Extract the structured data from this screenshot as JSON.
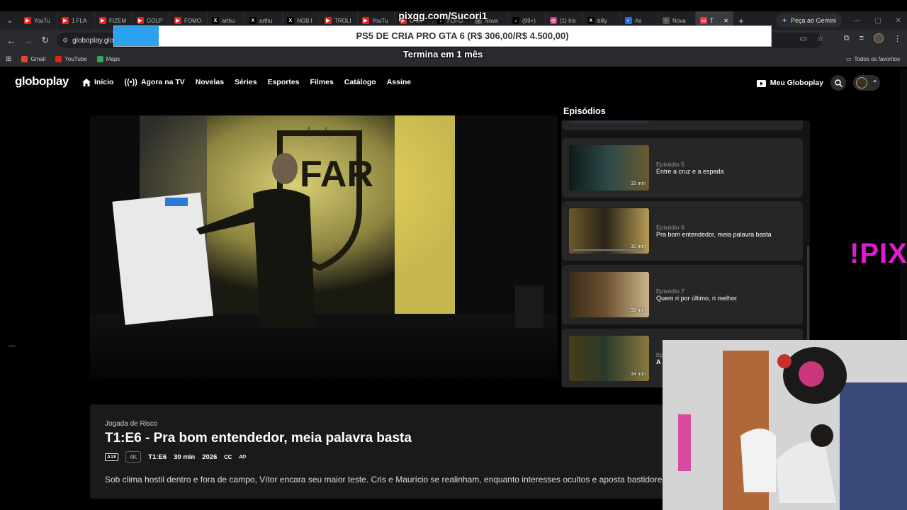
{
  "browser": {
    "tabs": [
      {
        "label": "YouTu",
        "color": "#e62117",
        "glyph": "▶"
      },
      {
        "label": "1 FLA",
        "color": "#e62117",
        "glyph": "▶"
      },
      {
        "label": "FIZEM",
        "color": "#e62117",
        "glyph": "▶"
      },
      {
        "label": "GOLP",
        "color": "#e62117",
        "glyph": "▶"
      },
      {
        "label": "FOMO",
        "color": "#e62117",
        "glyph": "▶"
      },
      {
        "label": "arthu",
        "color": "#000000",
        "glyph": "X"
      },
      {
        "label": "arthu",
        "color": "#000000",
        "glyph": "X"
      },
      {
        "label": "NGB I",
        "color": "#000000",
        "glyph": "X"
      },
      {
        "label": "TROLI",
        "color": "#e62117",
        "glyph": "▶"
      },
      {
        "label": "YouTu",
        "color": "#e62117",
        "glyph": "▶"
      },
      {
        "label": "O MI",
        "color": "#e62117",
        "glyph": "▶"
      },
      {
        "label": "FOFO",
        "color": "#000000",
        "glyph": "♪"
      },
      {
        "label": "Nova",
        "color": "#555555",
        "glyph": "○"
      },
      {
        "label": "(99+)",
        "color": "#000000",
        "glyph": "♪"
      },
      {
        "label": "(1) Ins",
        "color": "#c13584",
        "glyph": "◎"
      },
      {
        "label": "billy",
        "color": "#000000",
        "glyph": "X"
      },
      {
        "label": "As",
        "color": "#1a73e8",
        "glyph": "◐"
      },
      {
        "label": "Nova",
        "color": "#555555",
        "glyph": "○"
      },
      {
        "label": "T",
        "color": "#e9334a",
        "glyph": "▭"
      }
    ],
    "active_tab_index": 18,
    "gemini_label": "Peça ao Gemini",
    "url": "globoplay.glo",
    "bookmarks": [
      {
        "label": "Gmail",
        "color": "#ea4335"
      },
      {
        "label": "YouTube",
        "color": "#e62117"
      },
      {
        "label": "Maps",
        "color": "#34a853"
      }
    ],
    "all_bookmarks_label": "Todos os favoritos"
  },
  "overlay": {
    "title": "pixgg.com/Sucori1",
    "banner": "PS5 DE CRIA PRO GTA 6 (R$ 306,00/R$ 4.500,00)",
    "banner_progress": 0.068,
    "sub": "Termina em 1 mês",
    "pix": "!PIX"
  },
  "globoplay": {
    "logo": "globoplay",
    "nav": {
      "inicio": "Início",
      "agora": "Agora na TV",
      "novelas": "Novelas",
      "series": "Séries",
      "esportes": "Esportes",
      "filmes": "Filmes",
      "catalogo": "Catálogo",
      "assine": "Assine"
    },
    "meu_globoplay": "Meu Globoplay"
  },
  "episodes": {
    "title": "Episódios",
    "items": [
      {
        "num": "Episódio 5",
        "name": "Entre a cruz e a espada",
        "duration": "33 min"
      },
      {
        "num": "Episódio 6",
        "name": "Pra bom entendedor, meia palavra basta",
        "duration": "30 min"
      },
      {
        "num": "Episódio 7",
        "name": "Quem ri por último, ri melhor",
        "duration": "32 min"
      },
      {
        "num": "Ep",
        "name": "A",
        "duration": "34 min"
      }
    ]
  },
  "details": {
    "show": "Jogada de Risco",
    "title": "T1:E6 - Pra bom entendedor, meia palavra basta",
    "rating": "A18",
    "quality": "4K",
    "episode_code": "T1:E6",
    "duration": "30 min",
    "year": "2026",
    "cc": "CC",
    "ad": "AD",
    "synopsis": "Sob clima hostil dentro e fora de campo, Vítor encara seu maior teste. Cris e Maurício se realinham, enquanto interesses ocultos e aposta bastidores."
  }
}
